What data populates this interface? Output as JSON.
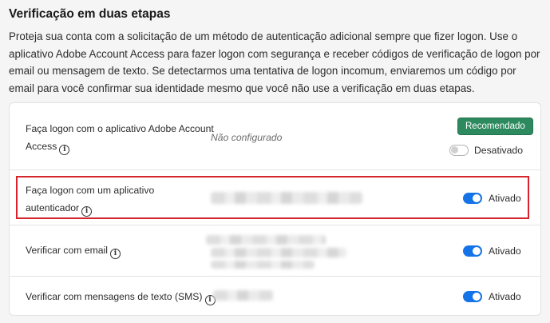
{
  "section": {
    "title": "Verificação em duas etapas",
    "description": "Proteja sua conta com a solicitação de um método de autenticação adicional sempre que fizer logon. Use o aplicativo Adobe Account Access para fazer logon com segurança e receber códigos de verificação de logon por email ou mensagem de texto. Se detectarmos uma tentativa de logon incomum, enviaremos um código por email para você confirmar sua identidade mesmo que você não use a verificação em duas etapas."
  },
  "methods": [
    {
      "label_line1": "Faça logon com o aplicativo Adobe Account",
      "label_line2": "Access",
      "status": "Não configurado",
      "badge": "Recomendado",
      "toggle_state": "off",
      "toggle_label": "Desativado",
      "info_icon": "info-icon"
    },
    {
      "label_line1": "Faça logon com um aplicativo",
      "label_line2": "autenticador",
      "toggle_state": "on",
      "toggle_label": "Ativado",
      "highlighted": true,
      "info_icon": "info-icon"
    },
    {
      "label": "Verificar com email",
      "toggle_state": "on",
      "toggle_label": "Ativado",
      "info_icon": "info-icon"
    },
    {
      "label": "Verificar com mensagens de texto (SMS)",
      "toggle_state": "on",
      "toggle_label": "Ativado",
      "info_icon": "info-icon"
    }
  ],
  "colors": {
    "accent": "#1473e6",
    "badge": "#2d8a5f",
    "highlight": "#d7242a"
  }
}
